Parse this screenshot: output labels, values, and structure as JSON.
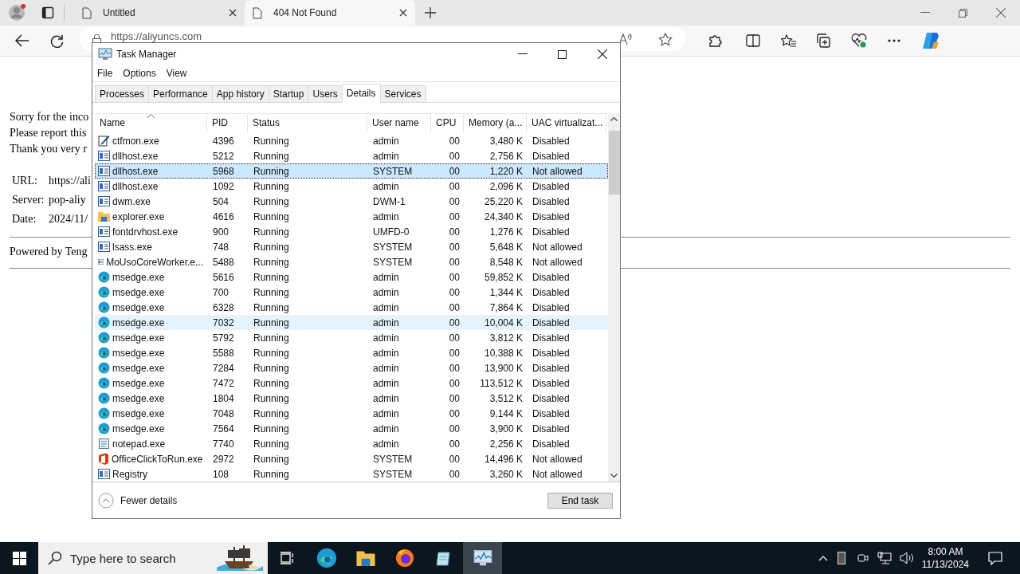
{
  "browser": {
    "tabs": [
      {
        "title": "Untitled",
        "selected": false
      },
      {
        "title": "404 Not Found",
        "selected": true
      }
    ],
    "address": "https://aliyuncs.com"
  },
  "page": {
    "lines": [
      "Sorry for the inco",
      "Please report this",
      "Thank you very r"
    ],
    "details": [
      {
        "label": "URL:",
        "value": "https://ali"
      },
      {
        "label": "Server:",
        "value": "pop-aliy"
      },
      {
        "label": "Date:",
        "value": "2024/11/"
      }
    ],
    "footer": "Powered by Teng"
  },
  "task_manager": {
    "title": "Task Manager",
    "menu": [
      "File",
      "Options",
      "View"
    ],
    "tabs": [
      {
        "label": "Processes",
        "selected": false
      },
      {
        "label": "Performance",
        "selected": false
      },
      {
        "label": "App history",
        "selected": false
      },
      {
        "label": "Startup",
        "selected": false
      },
      {
        "label": "Users",
        "selected": false
      },
      {
        "label": "Details",
        "selected": true
      },
      {
        "label": "Services",
        "selected": false
      }
    ],
    "columns": [
      "Name",
      "PID",
      "Status",
      "User name",
      "CPU",
      "Memory (a...",
      "UAC virtualizat..."
    ],
    "rows": [
      {
        "kind": "pen",
        "cells": [
          "ctfmon.exe",
          "4396",
          "Running",
          "admin",
          "00",
          "3,480 K",
          "Disabled"
        ],
        "selected": false,
        "hover": false
      },
      {
        "kind": "app",
        "cells": [
          "dllhost.exe",
          "5212",
          "Running",
          "admin",
          "00",
          "2,756 K",
          "Disabled"
        ],
        "selected": false,
        "hover": false
      },
      {
        "kind": "app",
        "cells": [
          "dllhost.exe",
          "5968",
          "Running",
          "SYSTEM",
          "00",
          "1,220 K",
          "Not allowed"
        ],
        "selected": true,
        "hover": false
      },
      {
        "kind": "app",
        "cells": [
          "dllhost.exe",
          "1092",
          "Running",
          "admin",
          "00",
          "2,096 K",
          "Disabled"
        ],
        "selected": false,
        "hover": false
      },
      {
        "kind": "app",
        "cells": [
          "dwm.exe",
          "504",
          "Running",
          "DWM-1",
          "00",
          "25,220 K",
          "Disabled"
        ],
        "selected": false,
        "hover": false
      },
      {
        "kind": "folder",
        "cells": [
          "explorer.exe",
          "4616",
          "Running",
          "admin",
          "00",
          "24,340 K",
          "Disabled"
        ],
        "selected": false,
        "hover": false
      },
      {
        "kind": "app",
        "cells": [
          "fontdrvhost.exe",
          "900",
          "Running",
          "UMFD-0",
          "00",
          "1,276 K",
          "Disabled"
        ],
        "selected": false,
        "hover": false
      },
      {
        "kind": "app",
        "cells": [
          "lsass.exe",
          "748",
          "Running",
          "SYSTEM",
          "00",
          "5,648 K",
          "Not allowed"
        ],
        "selected": false,
        "hover": false
      },
      {
        "kind": "app",
        "cells": [
          "MoUsoCoreWorker.e...",
          "5488",
          "Running",
          "SYSTEM",
          "00",
          "8,548 K",
          "Not allowed"
        ],
        "selected": false,
        "hover": false
      },
      {
        "kind": "edge",
        "cells": [
          "msedge.exe",
          "5616",
          "Running",
          "admin",
          "00",
          "59,852 K",
          "Disabled"
        ],
        "selected": false,
        "hover": false
      },
      {
        "kind": "edge",
        "cells": [
          "msedge.exe",
          "700",
          "Running",
          "admin",
          "00",
          "1,344 K",
          "Disabled"
        ],
        "selected": false,
        "hover": false
      },
      {
        "kind": "edge",
        "cells": [
          "msedge.exe",
          "6328",
          "Running",
          "admin",
          "00",
          "7,864 K",
          "Disabled"
        ],
        "selected": false,
        "hover": false
      },
      {
        "kind": "edge",
        "cells": [
          "msedge.exe",
          "7032",
          "Running",
          "admin",
          "00",
          "10,004 K",
          "Disabled"
        ],
        "selected": false,
        "hover": true
      },
      {
        "kind": "edge",
        "cells": [
          "msedge.exe",
          "5792",
          "Running",
          "admin",
          "00",
          "3,812 K",
          "Disabled"
        ],
        "selected": false,
        "hover": false
      },
      {
        "kind": "edge",
        "cells": [
          "msedge.exe",
          "5588",
          "Running",
          "admin",
          "00",
          "10,388 K",
          "Disabled"
        ],
        "selected": false,
        "hover": false
      },
      {
        "kind": "edge",
        "cells": [
          "msedge.exe",
          "7284",
          "Running",
          "admin",
          "00",
          "13,900 K",
          "Disabled"
        ],
        "selected": false,
        "hover": false
      },
      {
        "kind": "edge",
        "cells": [
          "msedge.exe",
          "7472",
          "Running",
          "admin",
          "00",
          "113,512 K",
          "Disabled"
        ],
        "selected": false,
        "hover": false
      },
      {
        "kind": "edge",
        "cells": [
          "msedge.exe",
          "1804",
          "Running",
          "admin",
          "00",
          "3,512 K",
          "Disabled"
        ],
        "selected": false,
        "hover": false
      },
      {
        "kind": "edge",
        "cells": [
          "msedge.exe",
          "7048",
          "Running",
          "admin",
          "00",
          "9,144 K",
          "Disabled"
        ],
        "selected": false,
        "hover": false
      },
      {
        "kind": "edge",
        "cells": [
          "msedge.exe",
          "7564",
          "Running",
          "admin",
          "00",
          "3,900 K",
          "Disabled"
        ],
        "selected": false,
        "hover": false
      },
      {
        "kind": "notepad",
        "cells": [
          "notepad.exe",
          "7740",
          "Running",
          "admin",
          "00",
          "2,256 K",
          "Disabled"
        ],
        "selected": false,
        "hover": false
      },
      {
        "kind": "office",
        "cells": [
          "OfficeClickToRun.exe",
          "2972",
          "Running",
          "SYSTEM",
          "00",
          "14,496 K",
          "Not allowed"
        ],
        "selected": false,
        "hover": false
      },
      {
        "kind": "app",
        "cells": [
          "Registry",
          "108",
          "Running",
          "SYSTEM",
          "00",
          "3,260 K",
          "Not allowed"
        ],
        "selected": false,
        "hover": false
      }
    ],
    "fewer_details": "Fewer details",
    "end_task": "End task"
  },
  "taskbar": {
    "search_placeholder": "Type here to search",
    "apps": [
      {
        "kind": "taskview",
        "active": false
      },
      {
        "kind": "edge",
        "active": false
      },
      {
        "kind": "folder",
        "active": false
      },
      {
        "kind": "firefox",
        "active": false
      },
      {
        "kind": "notepad",
        "active": false
      },
      {
        "kind": "taskmgr",
        "active": true
      }
    ],
    "time": "8:00 AM",
    "date": "11/13/2024"
  }
}
